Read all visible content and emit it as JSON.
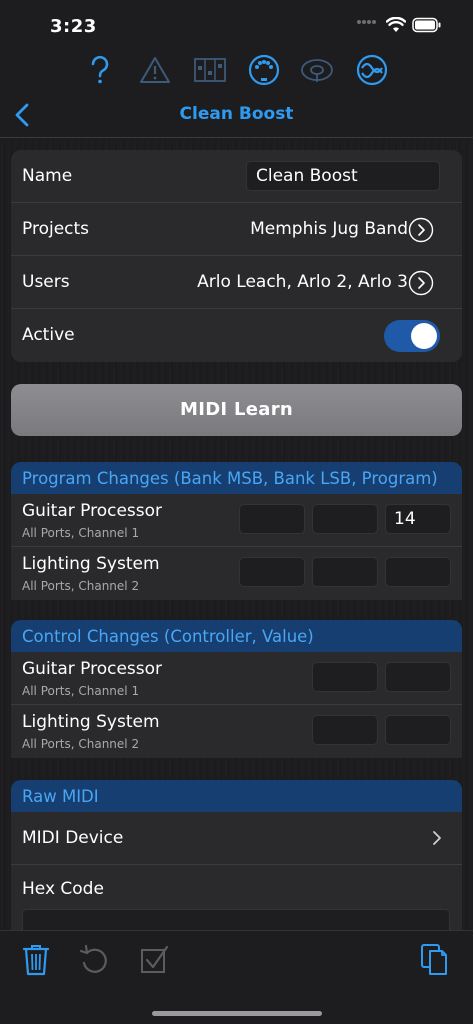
{
  "status": {
    "time": "3:23"
  },
  "topicons": [
    "help-icon",
    "warning-icon",
    "mixer-icon",
    "midi-port-icon",
    "routing-icon",
    "sync-icon"
  ],
  "nav": {
    "title": "Clean Boost"
  },
  "settings": {
    "name_label": "Name",
    "name_value": "Clean Boost",
    "projects_label": "Projects",
    "projects_value": "Memphis Jug Band",
    "users_label": "Users",
    "users_value": "Arlo Leach, Arlo 2, Arlo 3",
    "active_label": "Active",
    "active_on": true
  },
  "midi_learn": "MIDI Learn",
  "program_changes": {
    "header": "Program Changes (Bank MSB, Bank LSB, Program)",
    "rows": [
      {
        "name": "Guitar Processor",
        "sub": "All Ports, Channel 1",
        "msb": "",
        "lsb": "",
        "program": "14"
      },
      {
        "name": "Lighting System",
        "sub": "All Ports, Channel 2",
        "msb": "",
        "lsb": "",
        "program": ""
      }
    ]
  },
  "control_changes": {
    "header": "Control Changes (Controller, Value)",
    "rows": [
      {
        "name": "Guitar Processor",
        "sub": "All Ports, Channel 1",
        "controller": "",
        "value": ""
      },
      {
        "name": "Lighting System",
        "sub": "All Ports, Channel 2",
        "controller": "",
        "value": ""
      }
    ]
  },
  "raw_midi": {
    "header": "Raw MIDI",
    "device_label": "MIDI Device",
    "hex_label": "Hex Code"
  },
  "colors": {
    "accent": "#2f9bf0",
    "section_header_bg": "#173e70",
    "toggle_on": "#1f5aa8"
  }
}
